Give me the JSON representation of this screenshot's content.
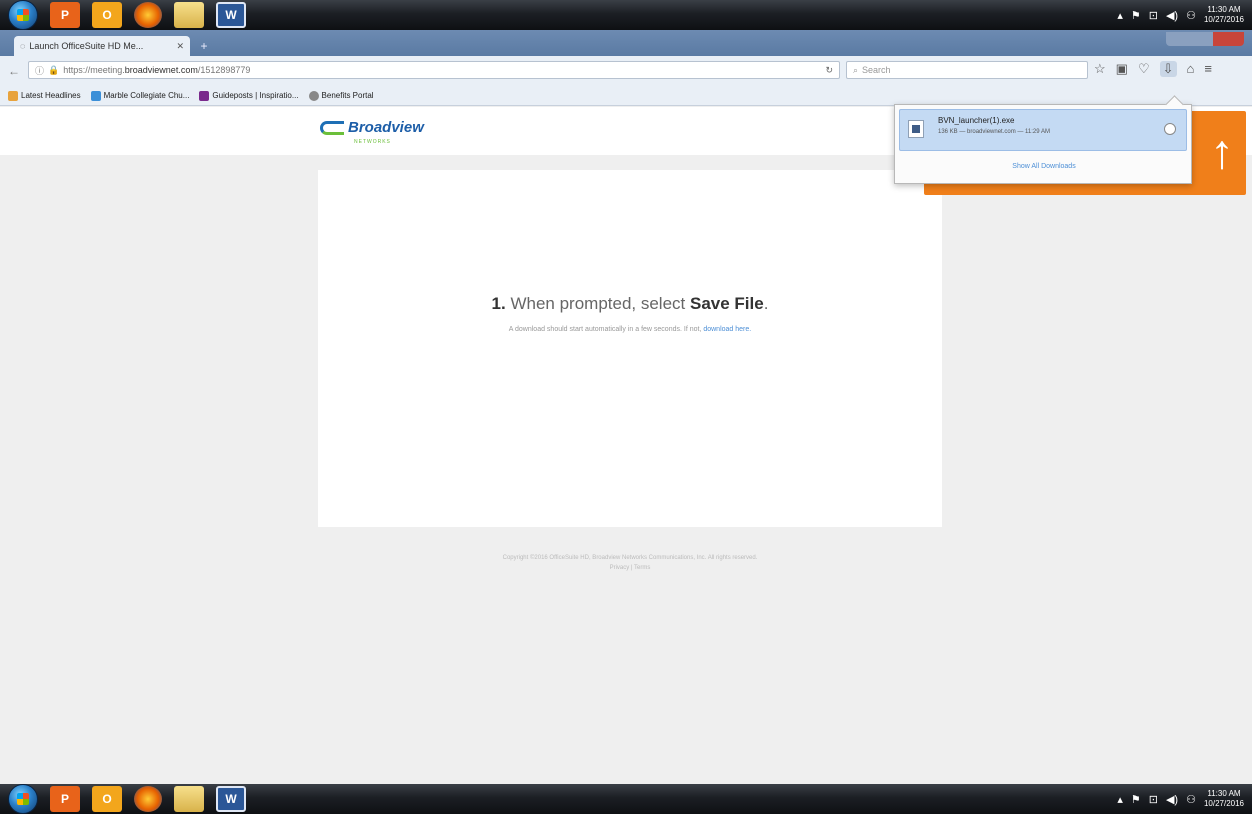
{
  "taskbar": {
    "apps": [
      {
        "icon": "powerpoint-icon",
        "label": "P"
      },
      {
        "icon": "outlook-icon",
        "label": "O"
      },
      {
        "icon": "firefox-icon",
        "label": ""
      },
      {
        "icon": "folder-icon",
        "label": ""
      },
      {
        "icon": "word-icon",
        "label": "W"
      }
    ],
    "time": "11:30 AM",
    "date": "10/27/2016"
  },
  "browser": {
    "tab_title": "Launch OfficeSuite HD Me...",
    "url_prefix": "https://meeting.",
    "url_domain": "broadviewnet.com",
    "url_suffix": "/1512898779",
    "search_placeholder": "Search",
    "bookmarks": [
      {
        "label": "Latest Headlines",
        "color": "#e8a33d"
      },
      {
        "label": "Marble Collegiate Chu...",
        "color": "#3b8fd8"
      },
      {
        "label": "Guideposts | Inspiratio...",
        "color": "#7a2a8c"
      },
      {
        "label": "Benefits Portal",
        "color": "#888888"
      }
    ]
  },
  "site": {
    "logo_text": "Broadview",
    "logo_sub": "NETWORKS"
  },
  "main": {
    "step_num": "1.",
    "step_text": " When prompted, select ",
    "step_strong": "Save File",
    "step_end": ".",
    "sub_text": "A download should start automatically in a few seconds. If not, ",
    "sub_link": "download here."
  },
  "footer": {
    "line1": "Copyright ©2016 OfficeSuite HD, Broadview Networks Communications, Inc. All rights reserved.",
    "line2": "Privacy | Terms"
  },
  "downloads": {
    "file_name": "BVN_launcher(1).exe",
    "status": "136 KB — broadviewnet.com — 11:29 AM",
    "show_all": "Show All Downloads"
  }
}
